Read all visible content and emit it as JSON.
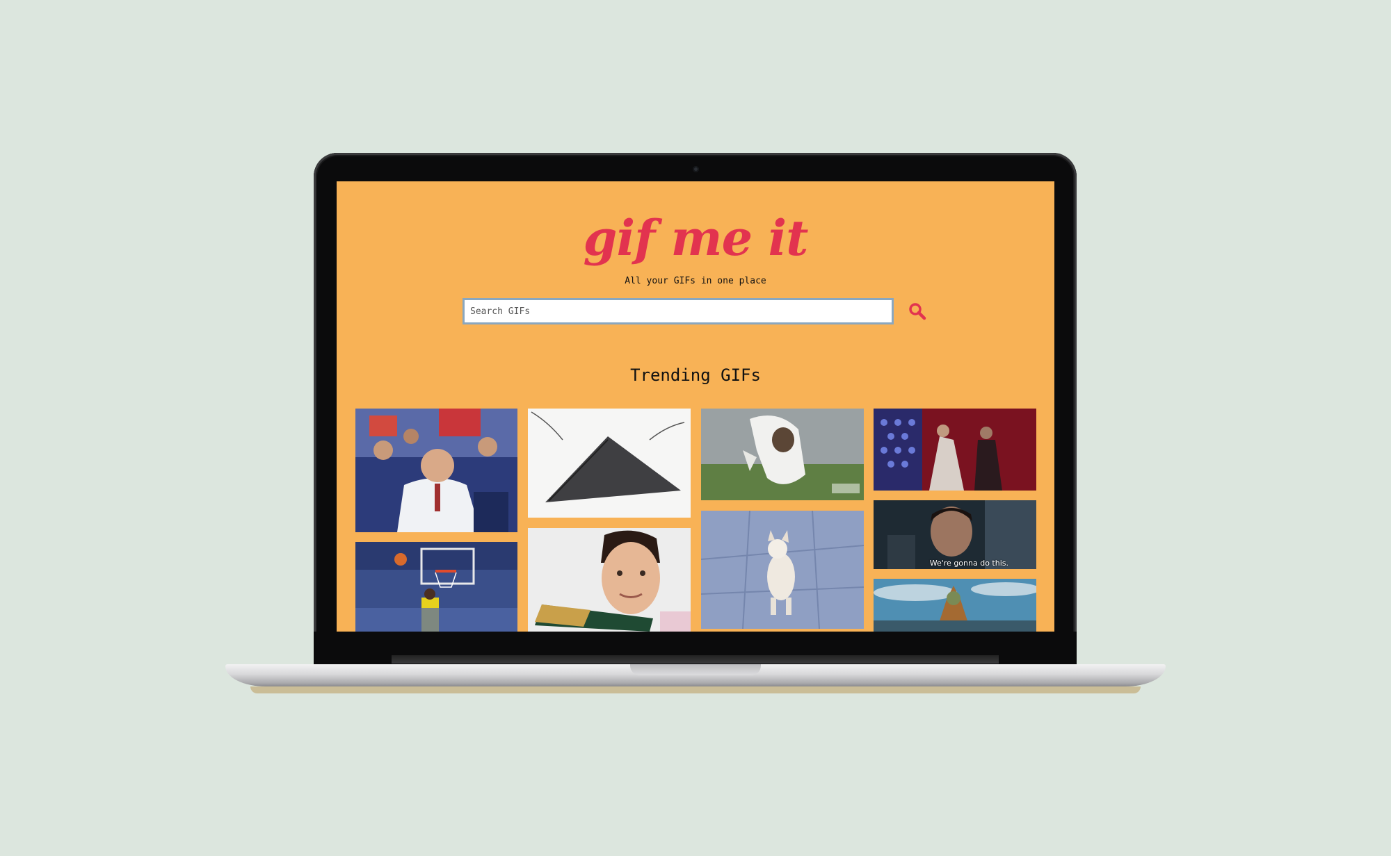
{
  "app": {
    "brand": "gif me it",
    "tagline": "All your GIFs in one place"
  },
  "search": {
    "placeholder": "Search GIFs",
    "value": "",
    "button_icon": "search-icon"
  },
  "trending": {
    "title": "Trending GIFs",
    "gifs": [
      {
        "name": "gif-coach-courtside",
        "caption": ""
      },
      {
        "name": "gif-basketball-dunk",
        "caption": ""
      },
      {
        "name": "gif-triangle-drawing",
        "caption": ""
      },
      {
        "name": "gif-champagne-man",
        "caption": ""
      },
      {
        "name": "gif-jumping-dog",
        "caption": ""
      },
      {
        "name": "gif-dancing-chihuahua",
        "caption": ""
      },
      {
        "name": "gif-red-room-dance",
        "caption": ""
      },
      {
        "name": "gif-pilot-cockpit",
        "caption": "We're gonna do this."
      },
      {
        "name": "gif-character-sky",
        "caption": ""
      }
    ]
  },
  "colors": {
    "page_bg": "#f8b256",
    "brand": "#e2334f",
    "input_border": "#8aa7bf",
    "desk_bg": "#dce6de"
  }
}
